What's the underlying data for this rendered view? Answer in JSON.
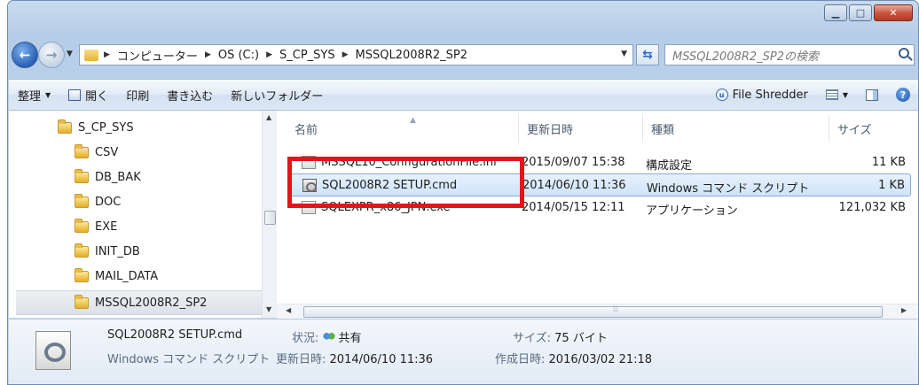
{
  "address": {
    "crumbs": [
      "コンピューター",
      "OS (C:)",
      "S_CP_SYS",
      "MSSQL2008R2_SP2"
    ],
    "search_placeholder": "MSSQL2008R2_SP2の検索"
  },
  "toolbar": {
    "organize": "整理",
    "open": "開く",
    "print": "印刷",
    "burn": "書き込む",
    "new_folder": "新しいフォルダー",
    "file_shredder": "File Shredder",
    "help": "?"
  },
  "navtree": [
    "S_CP_SYS",
    "CSV",
    "DB_BAK",
    "DOC",
    "EXE",
    "INIT_DB",
    "MAIL_DATA",
    "MSSQL2008R2_SP2"
  ],
  "columns": {
    "name": "名前",
    "modified": "更新日時",
    "type": "種類",
    "size": "サイズ"
  },
  "files": [
    {
      "name": "MSSQL10_ConfigurationFile.ini",
      "modified": "2015/09/07 15:38",
      "type": "構成設定",
      "size": "11 KB"
    },
    {
      "name": "SQL2008R2 SETUP.cmd",
      "modified": "2014/06/10 11:36",
      "type": "Windows コマンド スクリプト",
      "size": "1 KB"
    },
    {
      "name": "SQLEXPR_x86_JPN.exe",
      "modified": "2014/05/15 12:11",
      "type": "アプリケーション",
      "size": "121,032 KB"
    }
  ],
  "details": {
    "filename": "SQL2008R2 SETUP.cmd",
    "filetype": "Windows コマンド スクリプト",
    "status_label": "状況:",
    "status_value": "共有",
    "modified_label": "更新日時:",
    "modified_value": "2014/06/10 11:36",
    "size_label": "サイズ:",
    "size_value": "75 バイト",
    "created_label": "作成日時:",
    "created_value": "2016/03/02 21:18"
  },
  "colors": {
    "highlight": "#e8121a",
    "selection": "#cfe3fa"
  }
}
